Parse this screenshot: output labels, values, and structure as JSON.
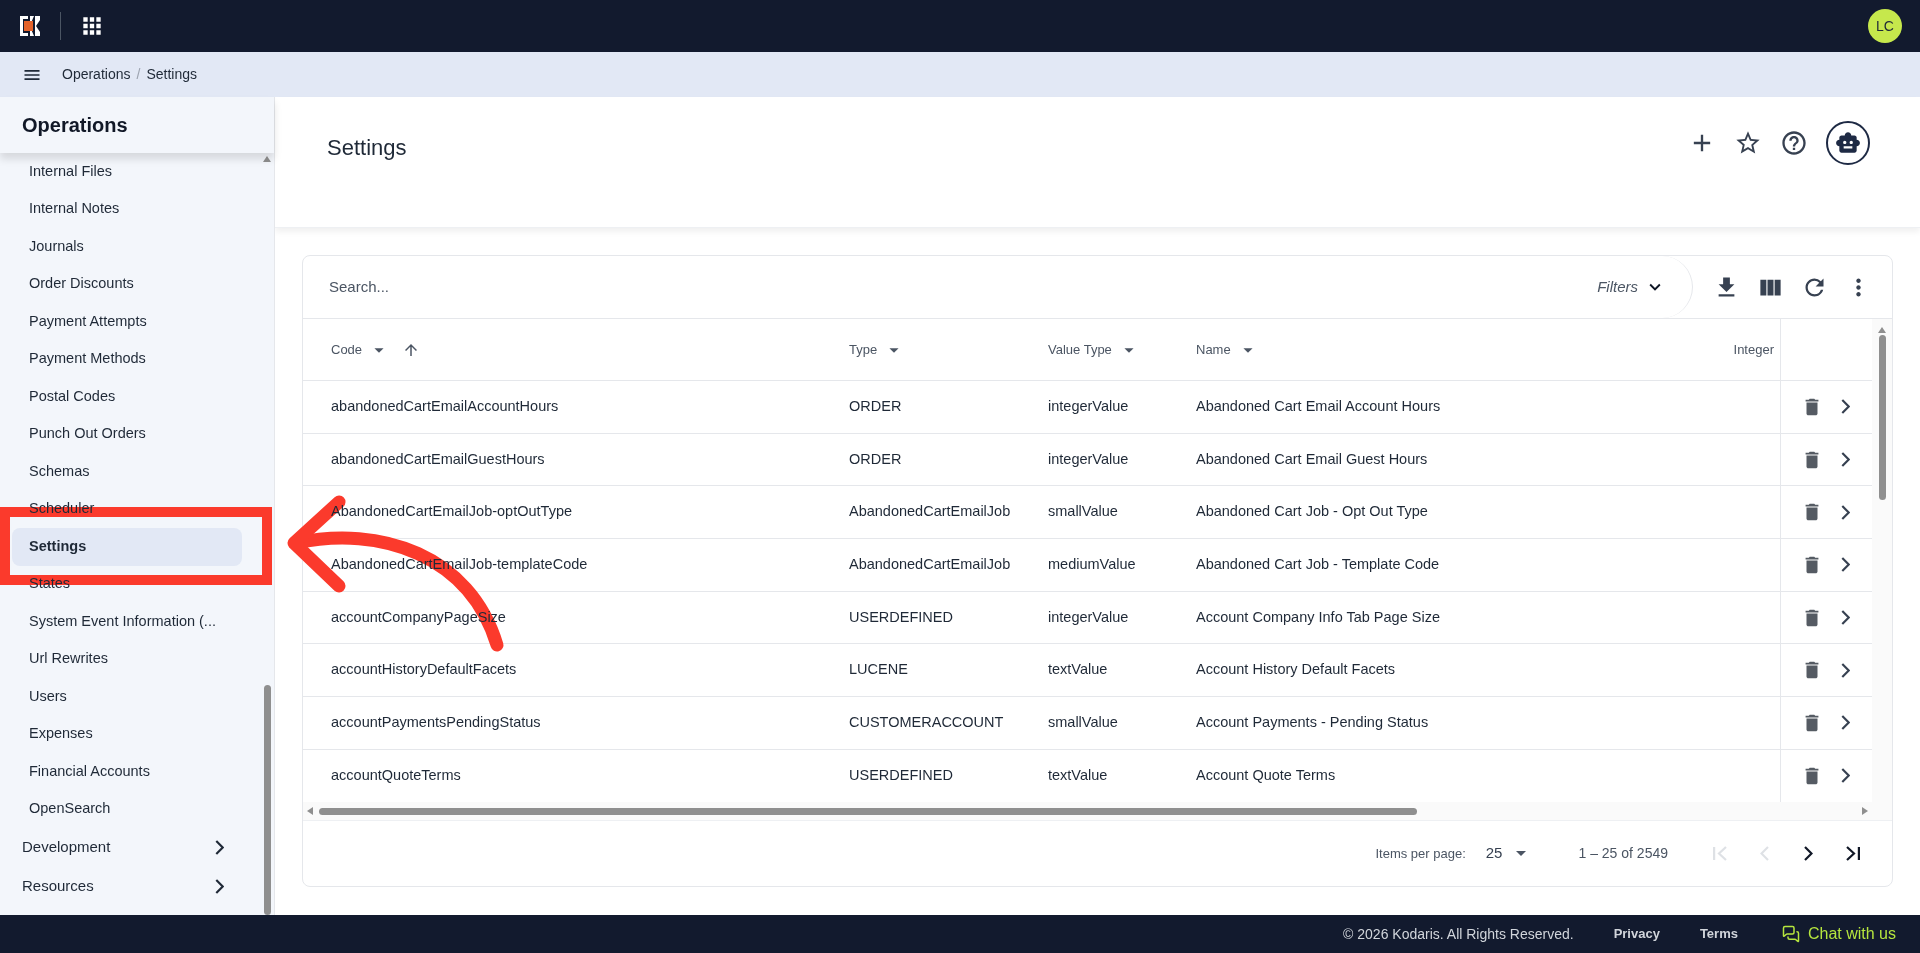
{
  "top_bar": {
    "avatar_initials": "LC"
  },
  "breadcrumb": [
    "Operations",
    "Settings"
  ],
  "breadcrumb_separator": "/",
  "sidebar": {
    "title": "Operations",
    "items": [
      {
        "label": "Internal Files",
        "selected": false
      },
      {
        "label": "Internal Notes",
        "selected": false
      },
      {
        "label": "Journals",
        "selected": false
      },
      {
        "label": "Order Discounts",
        "selected": false
      },
      {
        "label": "Payment Attempts",
        "selected": false
      },
      {
        "label": "Payment Methods",
        "selected": false
      },
      {
        "label": "Postal Codes",
        "selected": false
      },
      {
        "label": "Punch Out Orders",
        "selected": false
      },
      {
        "label": "Schemas",
        "selected": false
      },
      {
        "label": "Scheduler",
        "selected": false
      },
      {
        "label": "Settings",
        "selected": true
      },
      {
        "label": "States",
        "selected": false
      },
      {
        "label": "System Event Information (...",
        "selected": false
      },
      {
        "label": "Url Rewrites",
        "selected": false
      },
      {
        "label": "Users",
        "selected": false
      },
      {
        "label": "Expenses",
        "selected": false
      },
      {
        "label": "Financial Accounts",
        "selected": false
      },
      {
        "label": "OpenSearch",
        "selected": false
      }
    ],
    "sections": [
      {
        "label": "Development",
        "expanded": false
      },
      {
        "label": "Resources",
        "expanded": false
      }
    ]
  },
  "page": {
    "title": "Settings"
  },
  "table": {
    "search_placeholder": "Search...",
    "filters_label": "Filters",
    "columns": [
      {
        "label": "Code",
        "menu": true,
        "sorted": true
      },
      {
        "label": "Type",
        "menu": true,
        "sorted": false
      },
      {
        "label": "Value Type",
        "menu": true,
        "sorted": false
      },
      {
        "label": "Name",
        "menu": true,
        "sorted": false
      },
      {
        "label": "Integer",
        "menu": false,
        "sorted": false
      }
    ],
    "rows": [
      {
        "code": "abandonedCartEmailAccountHours",
        "type": "ORDER",
        "value_type": "integerValue",
        "name": "Abandoned Cart Email Account Hours"
      },
      {
        "code": "abandonedCartEmailGuestHours",
        "type": "ORDER",
        "value_type": "integerValue",
        "name": "Abandoned Cart Email Guest Hours"
      },
      {
        "code": "AbandonedCartEmailJob-optOutType",
        "type": "AbandonedCartEmailJob",
        "value_type": "smallValue",
        "name": "Abandoned Cart Job - Opt Out Type"
      },
      {
        "code": "AbandonedCartEmailJob-templateCode",
        "type": "AbandonedCartEmailJob",
        "value_type": "mediumValue",
        "name": "Abandoned Cart Job - Template Code"
      },
      {
        "code": "accountCompanyPageSize",
        "type": "USERDEFINED",
        "value_type": "integerValue",
        "name": "Account Company Info Tab Page Size"
      },
      {
        "code": "accountHistoryDefaultFacets",
        "type": "LUCENE",
        "value_type": "textValue",
        "name": "Account History Default Facets"
      },
      {
        "code": "accountPaymentsPendingStatus",
        "type": "CUSTOMERACCOUNT",
        "value_type": "smallValue",
        "name": "Account Payments - Pending Status"
      },
      {
        "code": "accountQuoteTerms",
        "type": "USERDEFINED",
        "value_type": "textValue",
        "name": "Account Quote Terms"
      }
    ]
  },
  "pagination": {
    "items_per_page_label": "Items per page:",
    "items_per_page": "25",
    "range": "1 – 25 of 2549",
    "buttons": [
      {
        "kind": "first",
        "disabled": true
      },
      {
        "kind": "prev",
        "disabled": true
      },
      {
        "kind": "next",
        "disabled": false
      },
      {
        "kind": "last",
        "disabled": false
      }
    ]
  },
  "footer": {
    "copyright": "© 2026 Kodaris. All Rights Reserved.",
    "links": [
      "Privacy",
      "Terms"
    ],
    "chat": "Chat with us"
  }
}
